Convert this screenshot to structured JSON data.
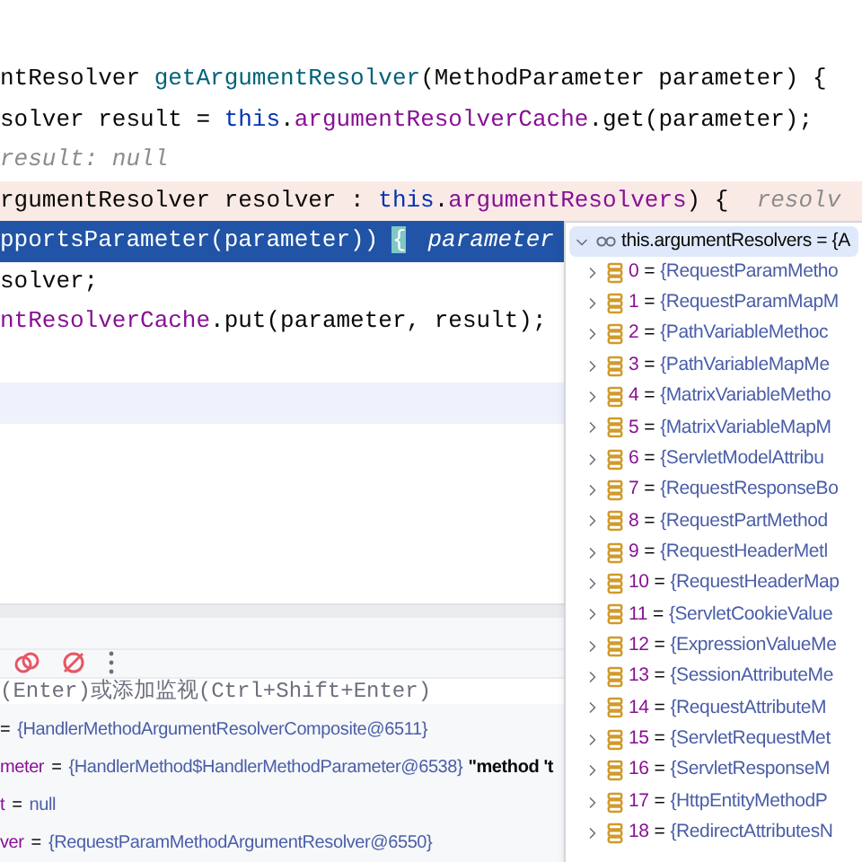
{
  "editor": {
    "lines": [
      {
        "kind": "normal",
        "segments": [
          {
            "kind": "plain",
            "text": "ntResolver "
          },
          {
            "kind": "method",
            "text": "getArgumentResolver"
          },
          {
            "kind": "plain",
            "text": "(MethodParameter parameter) {"
          }
        ]
      },
      {
        "kind": "normal",
        "segments": [
          {
            "kind": "plain",
            "text": "solver result = "
          },
          {
            "kind": "keyword",
            "text": "this"
          },
          {
            "kind": "plain",
            "text": "."
          },
          {
            "kind": "field",
            "text": "argumentResolverCache"
          },
          {
            "kind": "plain",
            "text": ".get(parameter);"
          }
        ]
      },
      {
        "kind": "normal",
        "segments": [
          {
            "kind": "hint",
            "text": "result: null"
          }
        ]
      },
      {
        "kind": "breakpoint",
        "segments": [
          {
            "kind": "plain",
            "text": "rgumentResolver resolver : "
          },
          {
            "kind": "keyword",
            "text": "this"
          },
          {
            "kind": "plain",
            "text": "."
          },
          {
            "kind": "field",
            "text": "argumentResolvers"
          },
          {
            "kind": "plain",
            "text": ") {  "
          },
          {
            "kind": "hint",
            "text": "resolv"
          }
        ]
      },
      {
        "kind": "selected",
        "segments": [
          {
            "kind": "plain",
            "text": "pportsParameter(parameter)) "
          },
          {
            "kind": "brace",
            "text": "{"
          },
          {
            "kind": "hint",
            "text": "parameter"
          }
        ]
      },
      {
        "kind": "normal",
        "segments": [
          {
            "kind": "plain",
            "text": "solver;"
          }
        ]
      },
      {
        "kind": "normal",
        "segments": [
          {
            "kind": "field",
            "text": "ntResolverCache"
          },
          {
            "kind": "plain",
            "text": ".put(parameter, result);"
          }
        ]
      },
      {
        "kind": "normal"
      },
      {
        "kind": "current"
      }
    ]
  },
  "debug": {
    "watch": {
      "placeholder": "(Enter)或添加监视(Ctrl+Shift+Enter)"
    },
    "variables": [
      {
        "sep": "=",
        "value": "{HandlerMethodArgumentResolverComposite@6511}"
      },
      {
        "name": "meter",
        "sep": "=",
        "value": "{HandlerMethod$HandlerMethodParameter@6538}",
        "extra": "\"method 't"
      },
      {
        "name": "t",
        "sep": "=",
        "value": "null"
      },
      {
        "name": "ver",
        "sep": "=",
        "value": "{RequestParamMethodArgumentResolver@6550}"
      }
    ]
  },
  "popup": {
    "title": "this.argumentResolvers = {A",
    "expanded": true,
    "items": [
      {
        "index": "0",
        "sep": "=",
        "value": "{RequestParamMetho"
      },
      {
        "index": "1",
        "sep": "=",
        "value": "{RequestParamMapM"
      },
      {
        "index": "2",
        "sep": "=",
        "value": "{PathVariableMethoc"
      },
      {
        "index": "3",
        "sep": "=",
        "value": "{PathVariableMapMe"
      },
      {
        "index": "4",
        "sep": "=",
        "value": "{MatrixVariableMetho"
      },
      {
        "index": "5",
        "sep": "=",
        "value": "{MatrixVariableMapM"
      },
      {
        "index": "6",
        "sep": "=",
        "value": "{ServletModelAttribu"
      },
      {
        "index": "7",
        "sep": "=",
        "value": "{RequestResponseBo"
      },
      {
        "index": "8",
        "sep": "=",
        "value": "{RequestPartMethod"
      },
      {
        "index": "9",
        "sep": "=",
        "value": "{RequestHeaderMetl"
      },
      {
        "index": "10",
        "sep": "=",
        "value": "{RequestHeaderMap"
      },
      {
        "index": "11",
        "sep": "=",
        "value": "{ServletCookieValue"
      },
      {
        "index": "12",
        "sep": "=",
        "value": "{ExpressionValueMe"
      },
      {
        "index": "13",
        "sep": "=",
        "value": "{SessionAttributeMe"
      },
      {
        "index": "14",
        "sep": "=",
        "value": "{RequestAttributeM"
      },
      {
        "index": "15",
        "sep": "=",
        "value": "{ServletRequestMet"
      },
      {
        "index": "16",
        "sep": "=",
        "value": "{ServletResponseM"
      },
      {
        "index": "17",
        "sep": "=",
        "value": "{HttpEntityMethodP"
      },
      {
        "index": "18",
        "sep": "=",
        "value": "{RedirectAttributesN"
      }
    ]
  }
}
